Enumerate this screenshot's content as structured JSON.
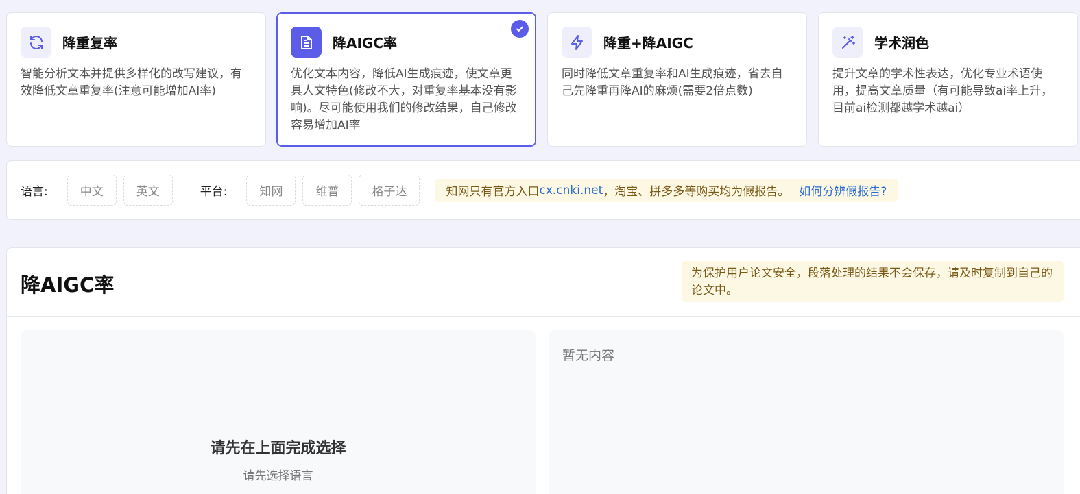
{
  "modes": [
    {
      "title": "降重复率",
      "icon": "refresh-icon",
      "description": "智能分析文本并提供多样化的改写建议，有效降低文章重复率(注意可能增加AI率)",
      "selected": false
    },
    {
      "title": "降AIGC率",
      "icon": "document-icon",
      "description": "优化文本内容，降低AI生成痕迹，使文章更具人文特色(修改不大，对重复率基本没有影响)。尽可能使用我们的修改结果，自己修改容易增加AI率",
      "selected": true
    },
    {
      "title": "降重+降AIGC",
      "icon": "lightning-icon",
      "description": "同时降低文章重复率和AI生成痕迹，省去自己先降重再降AI的麻烦(需要2倍点数)",
      "selected": false
    },
    {
      "title": "学术润色",
      "icon": "magic-wand-icon",
      "description": "提升文章的学术性表达，优化专业术语使用，提高文章质量（有可能导致ai率上升，目前ai检测都越学术越ai）",
      "selected": false
    }
  ],
  "filters": {
    "language_label": "语言:",
    "languages": [
      "中文",
      "英文"
    ],
    "platform_label": "平台:",
    "platforms": [
      "知网",
      "维普",
      "格子达"
    ],
    "notice_prefix": "知网只有官方入口 ",
    "notice_site": "cx.cnki.net",
    "notice_suffix": "，淘宝、拼多多等购买均为假报告。",
    "notice_link": "如何分辨假报告?"
  },
  "main": {
    "title": "降AIGC率",
    "save_tip": "为保护用户论文安全，段落处理的结果不会保存，请及时复制到自己的论文中。",
    "input_empty_title": "请先在上面完成选择",
    "input_empty_subtitle": "请先选择语言",
    "output_empty": "暂无内容"
  },
  "colors": {
    "accent": "#5b5ce8",
    "notice_bg": "#fdf8e3",
    "link": "#2a6cd1"
  }
}
